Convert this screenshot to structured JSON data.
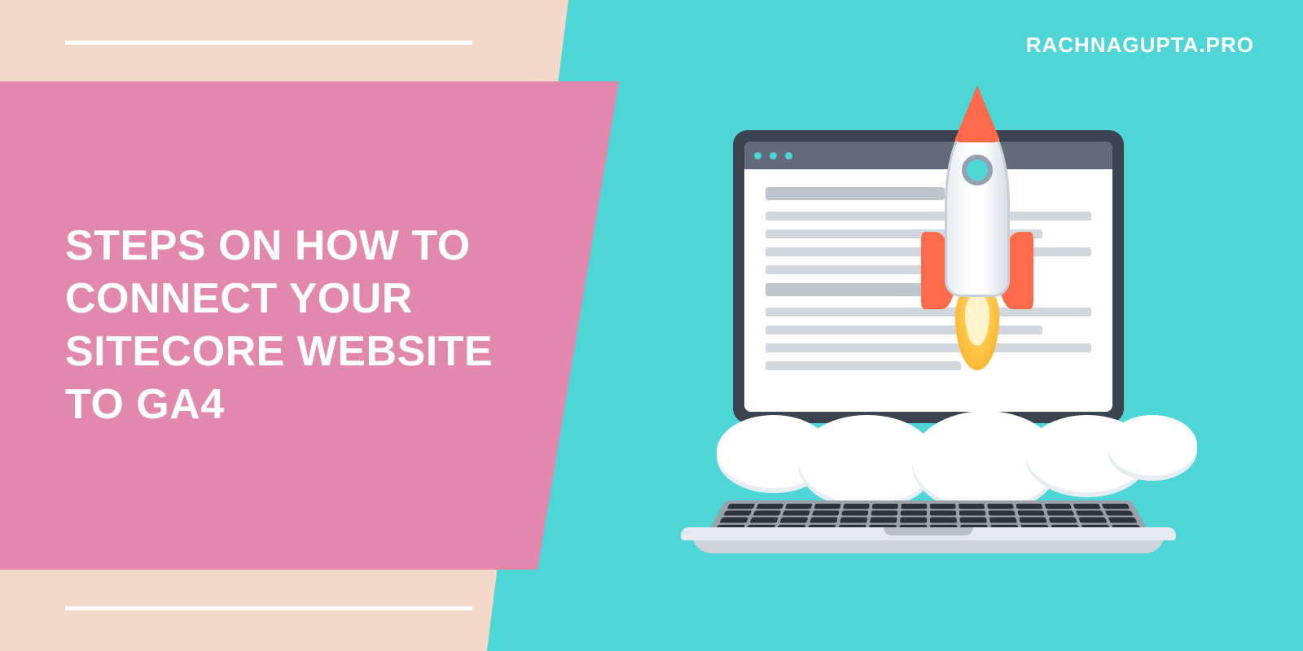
{
  "brand": "RACHNAGUPTA.PRO",
  "headline": "STEPS ON HOW TO CONNECT YOUR SITECORE WEBSITE TO GA4",
  "colors": {
    "cyan": "#4ed6d6",
    "pink": "#e188ac",
    "peach": "#f2d9c9",
    "white": "#ffffff",
    "orange": "#ff6b4a"
  },
  "illustration": {
    "name": "laptop-rocket-launch",
    "elements": [
      "laptop",
      "browser-window",
      "document-lines",
      "rocket",
      "flame",
      "clouds"
    ]
  }
}
